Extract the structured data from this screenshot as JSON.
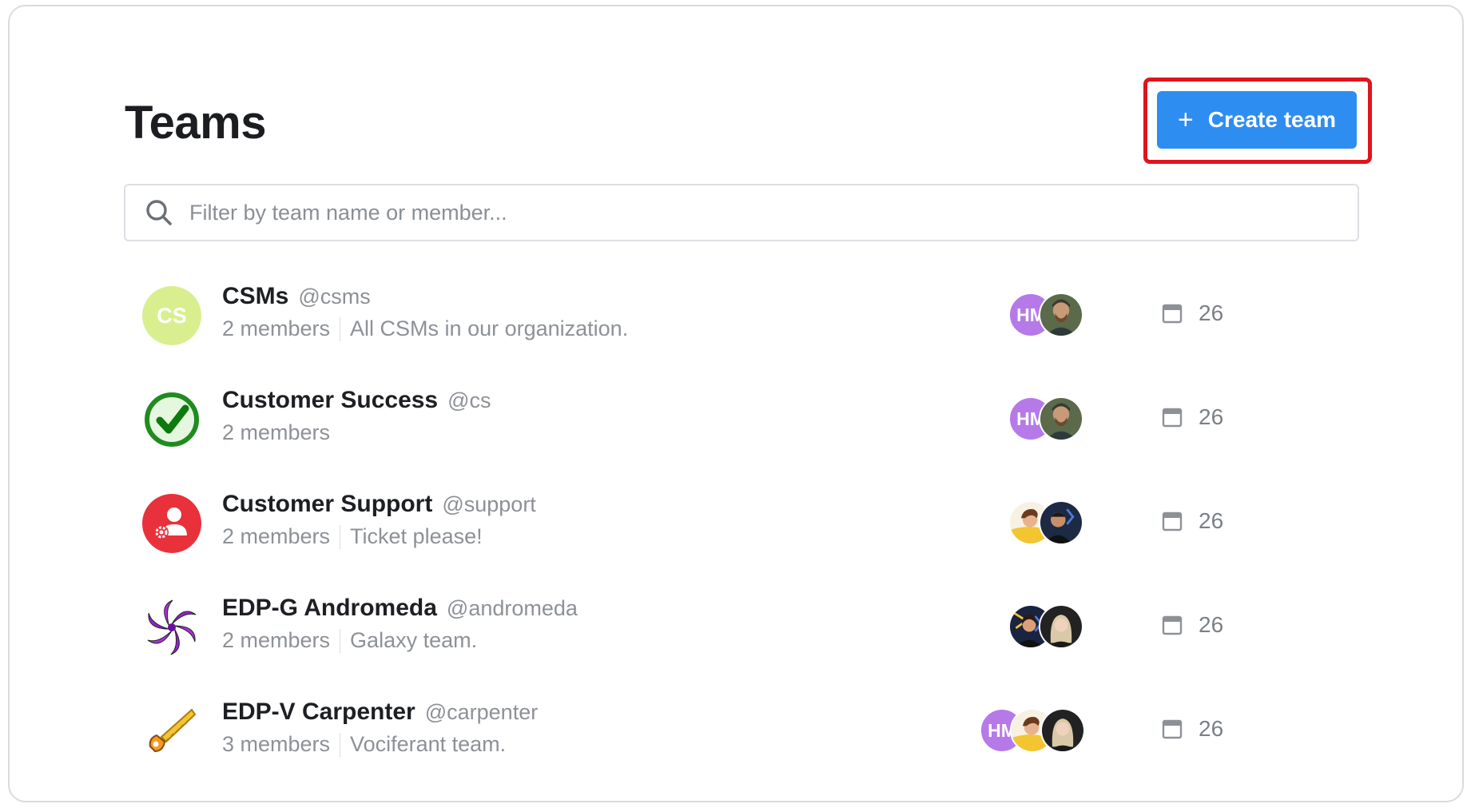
{
  "header": {
    "title": "Teams",
    "create_button": {
      "icon": "plus-icon",
      "label": "Create team"
    }
  },
  "search": {
    "icon": "search-icon",
    "placeholder": "Filter by team name or member..."
  },
  "colors": {
    "accent": "#2d8df0",
    "highlight": "#e0141d",
    "hm_avatar": "#b57ae8"
  },
  "teams": [
    {
      "name": "CSMs",
      "handle": "@csms",
      "members": "2 members",
      "description": "All CSMs in our organization.",
      "logo": "cs-initials-avatar",
      "logo_text": "CS",
      "avatars": [
        {
          "type": "initials",
          "text": "HM"
        },
        {
          "type": "photo",
          "name": "man-photo-avatar"
        }
      ],
      "count": "26"
    },
    {
      "name": "Customer Success",
      "handle": "@cs",
      "members": "2 members",
      "description": "",
      "logo": "green-check-icon",
      "avatars": [
        {
          "type": "initials",
          "text": "HM"
        },
        {
          "type": "photo",
          "name": "man-photo-avatar"
        }
      ],
      "count": "26"
    },
    {
      "name": "Customer Support",
      "handle": "@support",
      "members": "2 members",
      "description": "Ticket please!",
      "logo": "support-agent-icon",
      "avatars": [
        {
          "type": "photo",
          "name": "woman-yellow-avatar"
        },
        {
          "type": "photo",
          "name": "man-dark-avatar"
        }
      ],
      "count": "26"
    },
    {
      "name": "EDP-G Andromeda",
      "handle": "@andromeda",
      "members": "2 members",
      "description": "Galaxy team.",
      "logo": "galaxy-icon",
      "avatars": [
        {
          "type": "photo",
          "name": "woman-dark-avatar"
        },
        {
          "type": "photo",
          "name": "woman-blonde-avatar"
        }
      ],
      "count": "26"
    },
    {
      "name": "EDP-V Carpenter",
      "handle": "@carpenter",
      "members": "3 members",
      "description": "Vociferant team.",
      "logo": "saw-icon",
      "avatars": [
        {
          "type": "initials",
          "text": "HM"
        },
        {
          "type": "photo",
          "name": "woman-yellow-avatar"
        },
        {
          "type": "photo",
          "name": "woman-blonde-avatar"
        }
      ],
      "count": "26"
    }
  ]
}
